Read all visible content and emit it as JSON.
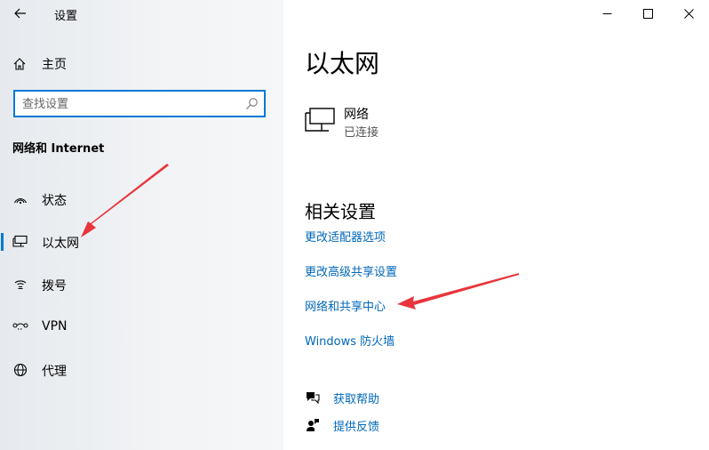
{
  "window": {
    "title": "设置"
  },
  "sidebar": {
    "home_label": "主页",
    "search_placeholder": "查找设置",
    "section_title": "网络和 Internet",
    "items": [
      {
        "label": "状态",
        "icon": "status-icon"
      },
      {
        "label": "以太网",
        "icon": "ethernet-icon",
        "selected": true
      },
      {
        "label": "拨号",
        "icon": "dialup-icon"
      },
      {
        "label": "VPN",
        "icon": "vpn-icon"
      },
      {
        "label": "代理",
        "icon": "proxy-globe-icon"
      }
    ]
  },
  "main": {
    "title": "以太网",
    "network": {
      "name": "网络",
      "status": "已连接",
      "icon": "ethernet-monitor-icon"
    },
    "related": {
      "title": "相关设置",
      "links": [
        "更改适配器选项",
        "更改高级共享设置",
        "网络和共享中心",
        "Windows 防火墙"
      ]
    },
    "help": [
      {
        "label": "获取帮助",
        "icon": "help-chat-icon"
      },
      {
        "label": "提供反馈",
        "icon": "feedback-icon"
      }
    ]
  },
  "colors": {
    "accent": "#0078d7",
    "link": "#0067b8",
    "annotation_arrow": "#e8353b"
  }
}
